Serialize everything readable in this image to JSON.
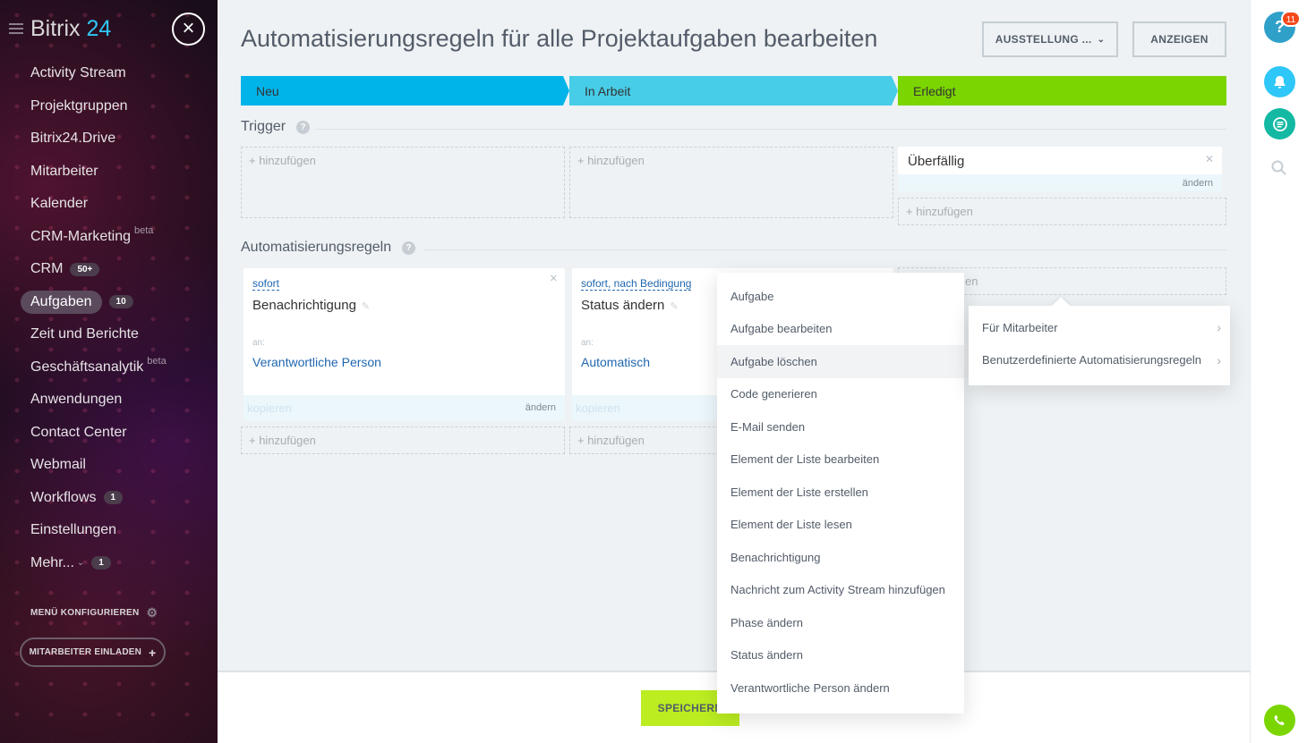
{
  "sidebar": {
    "logo_main": "Bitrix",
    "logo_num": "24",
    "items": [
      {
        "label": "Activity Stream"
      },
      {
        "label": "Projektgruppen"
      },
      {
        "label": "Bitrix24.Drive"
      },
      {
        "label": "Mitarbeiter"
      },
      {
        "label": "Kalender"
      },
      {
        "label": "CRM-Marketing",
        "beta": "beta"
      },
      {
        "label": "CRM",
        "count": "50+"
      },
      {
        "label": "Aufgaben",
        "count": "10"
      },
      {
        "label": "Zeit und Berichte"
      },
      {
        "label": "Geschäftsanalytik",
        "beta": "beta"
      },
      {
        "label": "Anwendungen"
      },
      {
        "label": "Contact Center"
      },
      {
        "label": "Webmail"
      },
      {
        "label": "Workflows",
        "count": "1"
      },
      {
        "label": "Einstellungen"
      },
      {
        "label": "Mehr...",
        "count": "1"
      }
    ],
    "configure_menu": "MENÜ KONFIGURIEREN",
    "invite_button": "MITARBEITER EINLADEN"
  },
  "header": {
    "title": "Automatisierungsregeln für alle Projektaufgaben bearbeiten",
    "exhibition_button": "AUSSTELLUNG ...",
    "show_button": "ANZEIGEN"
  },
  "stages": [
    {
      "label": "Neu",
      "color": "#00b4ea"
    },
    {
      "label": "In Arbeit",
      "color": "#47cde8"
    },
    {
      "label": "Erledigt",
      "color": "#7bd500"
    }
  ],
  "triggers": {
    "title": "Trigger",
    "add_label": "+ hinzufügen",
    "overdue_card": {
      "name": "Überfällig",
      "edit": "ändern"
    }
  },
  "rules": {
    "title": "Automatisierungsregeln",
    "add_label": "+ hinzufügen",
    "cards": [
      {
        "condition": "sofort",
        "title": "Benachrichtigung",
        "to_label": "an:",
        "recipient": "Verantwortliche Person",
        "copy": "kopieren",
        "edit": "ändern"
      },
      {
        "condition": "sofort, nach Bedingung",
        "title": "Status ändern",
        "to_label": "an:",
        "recipient": "Automatisch",
        "copy": "kopieren"
      }
    ],
    "partial_text": "en"
  },
  "dropdown": {
    "items": [
      "Aufgabe",
      "Aufgabe bearbeiten",
      "Aufgabe löschen",
      "Code generieren",
      "E-Mail senden",
      "Element der Liste bearbeiten",
      "Element der Liste erstellen",
      "Element der Liste lesen",
      "Benachrichtigung",
      "Nachricht zum Activity Stream hinzufügen",
      "Phase ändern",
      "Status ändern",
      "Verantwortliche Person ändern"
    ],
    "hovered_index": 2
  },
  "submenu": {
    "items": [
      "Für Mitarbeiter",
      "Benutzerdefinierte Automatisierungsregeln"
    ]
  },
  "footer": {
    "save_button": "SPEICHERN"
  },
  "right_rail": {
    "help_badge": "11"
  }
}
